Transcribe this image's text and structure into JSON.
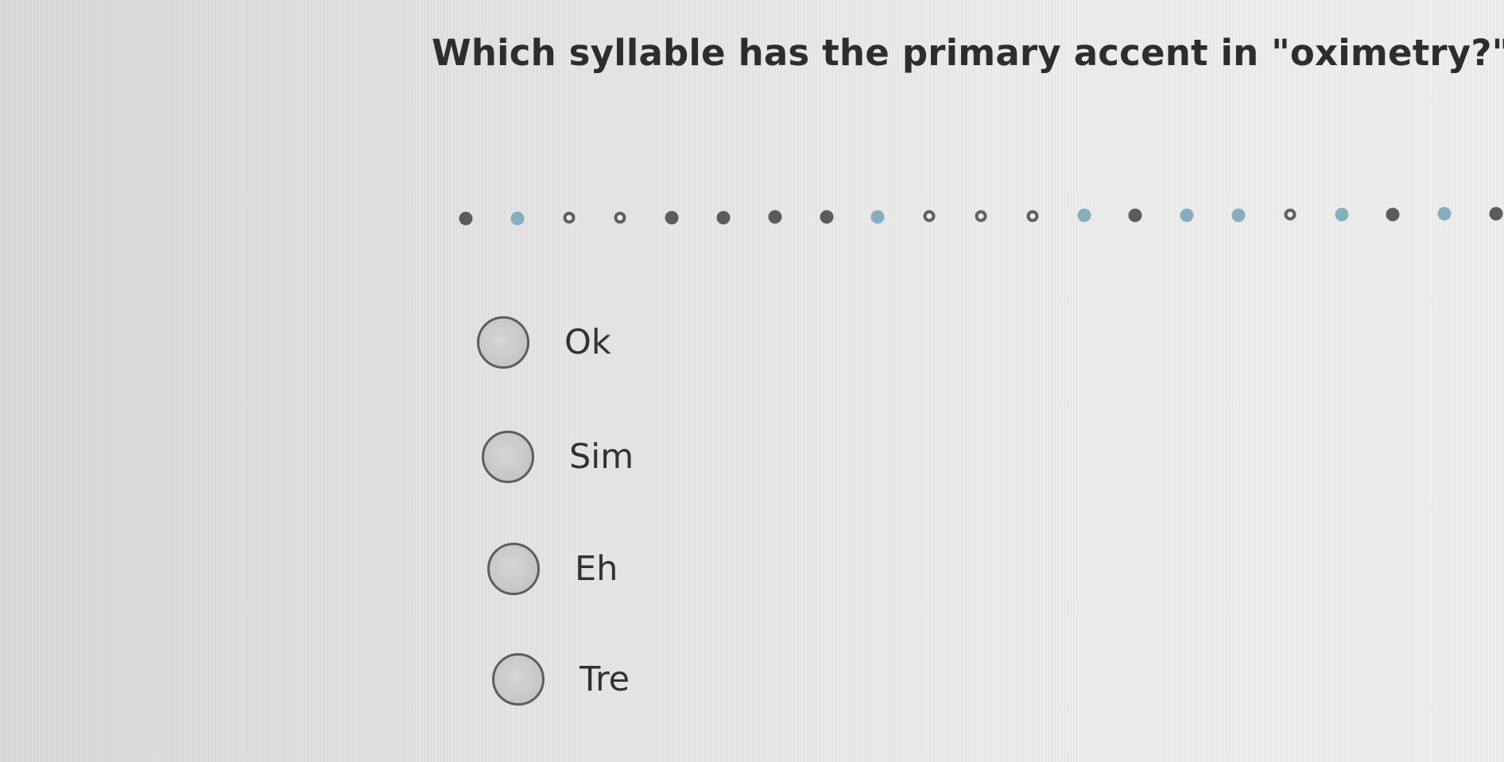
{
  "question": {
    "text": "Which syllable has the primary accent in \"oximetry?\""
  },
  "progress": {
    "dot_states": [
      "answered",
      "current",
      "open",
      "open",
      "answered",
      "answered",
      "answered",
      "answered",
      "current",
      "open",
      "open",
      "open",
      "current",
      "answered",
      "current",
      "current",
      "open",
      "current",
      "answered",
      "current",
      "answered"
    ]
  },
  "options": [
    {
      "label": "Ok",
      "selected": false
    },
    {
      "label": "Sim",
      "selected": false
    },
    {
      "label": "Eh",
      "selected": false
    },
    {
      "label": "Tre",
      "selected": false
    }
  ],
  "colors": {
    "answered": "#5b5b5b",
    "current": "#86aebd",
    "open_ring": "#5f5f5f"
  }
}
